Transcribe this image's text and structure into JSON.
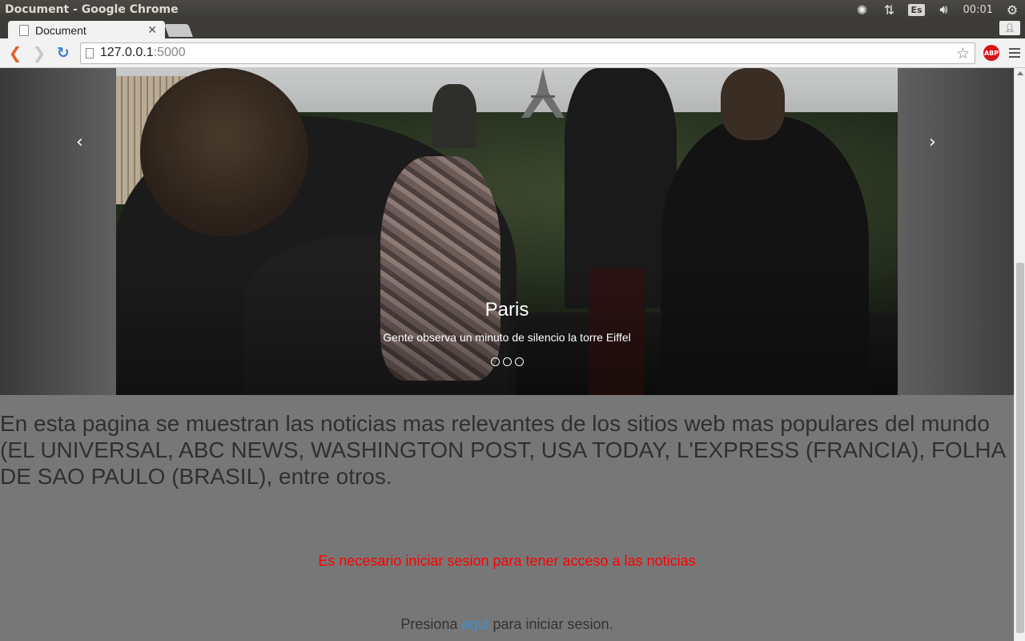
{
  "os": {
    "window_title": "Document - Google Chrome",
    "language": "Es",
    "clock": "00:01",
    "icons": [
      "brightness-icon",
      "network-arrows-icon",
      "volume-icon",
      "power-gear-icon"
    ]
  },
  "browser": {
    "tab_title": "Document",
    "url_host": "127.0.0.1",
    "url_port": ":5000",
    "adblock_label": "ABP"
  },
  "carousel": {
    "prev_symbol": "‹",
    "next_symbol": "›",
    "caption_title": "Paris",
    "caption_text": "Gente observa un minuto de silencio la torre Eiffel",
    "slide_count": 3,
    "active_index": 0
  },
  "page": {
    "intro": "En esta pagina se muestran las noticias mas relevantes de los sitios web mas populares del mundo (EL UNIVERSAL, ABC NEWS, WASHINGTON POST, USA TODAY, L'EXPRESS (FRANCIA), FOLHA DE SAO PAULO (BRASIL), entre otros.",
    "alert": "Es necesario iniciar sesion para tener acceso a las noticias",
    "login_prefix": "Presiona ",
    "login_link": "aqui",
    "login_suffix": " para iniciar sesion."
  },
  "colors": {
    "page_bg": "#777777",
    "alert": "#ff0000",
    "link": "#3f8fd4"
  }
}
